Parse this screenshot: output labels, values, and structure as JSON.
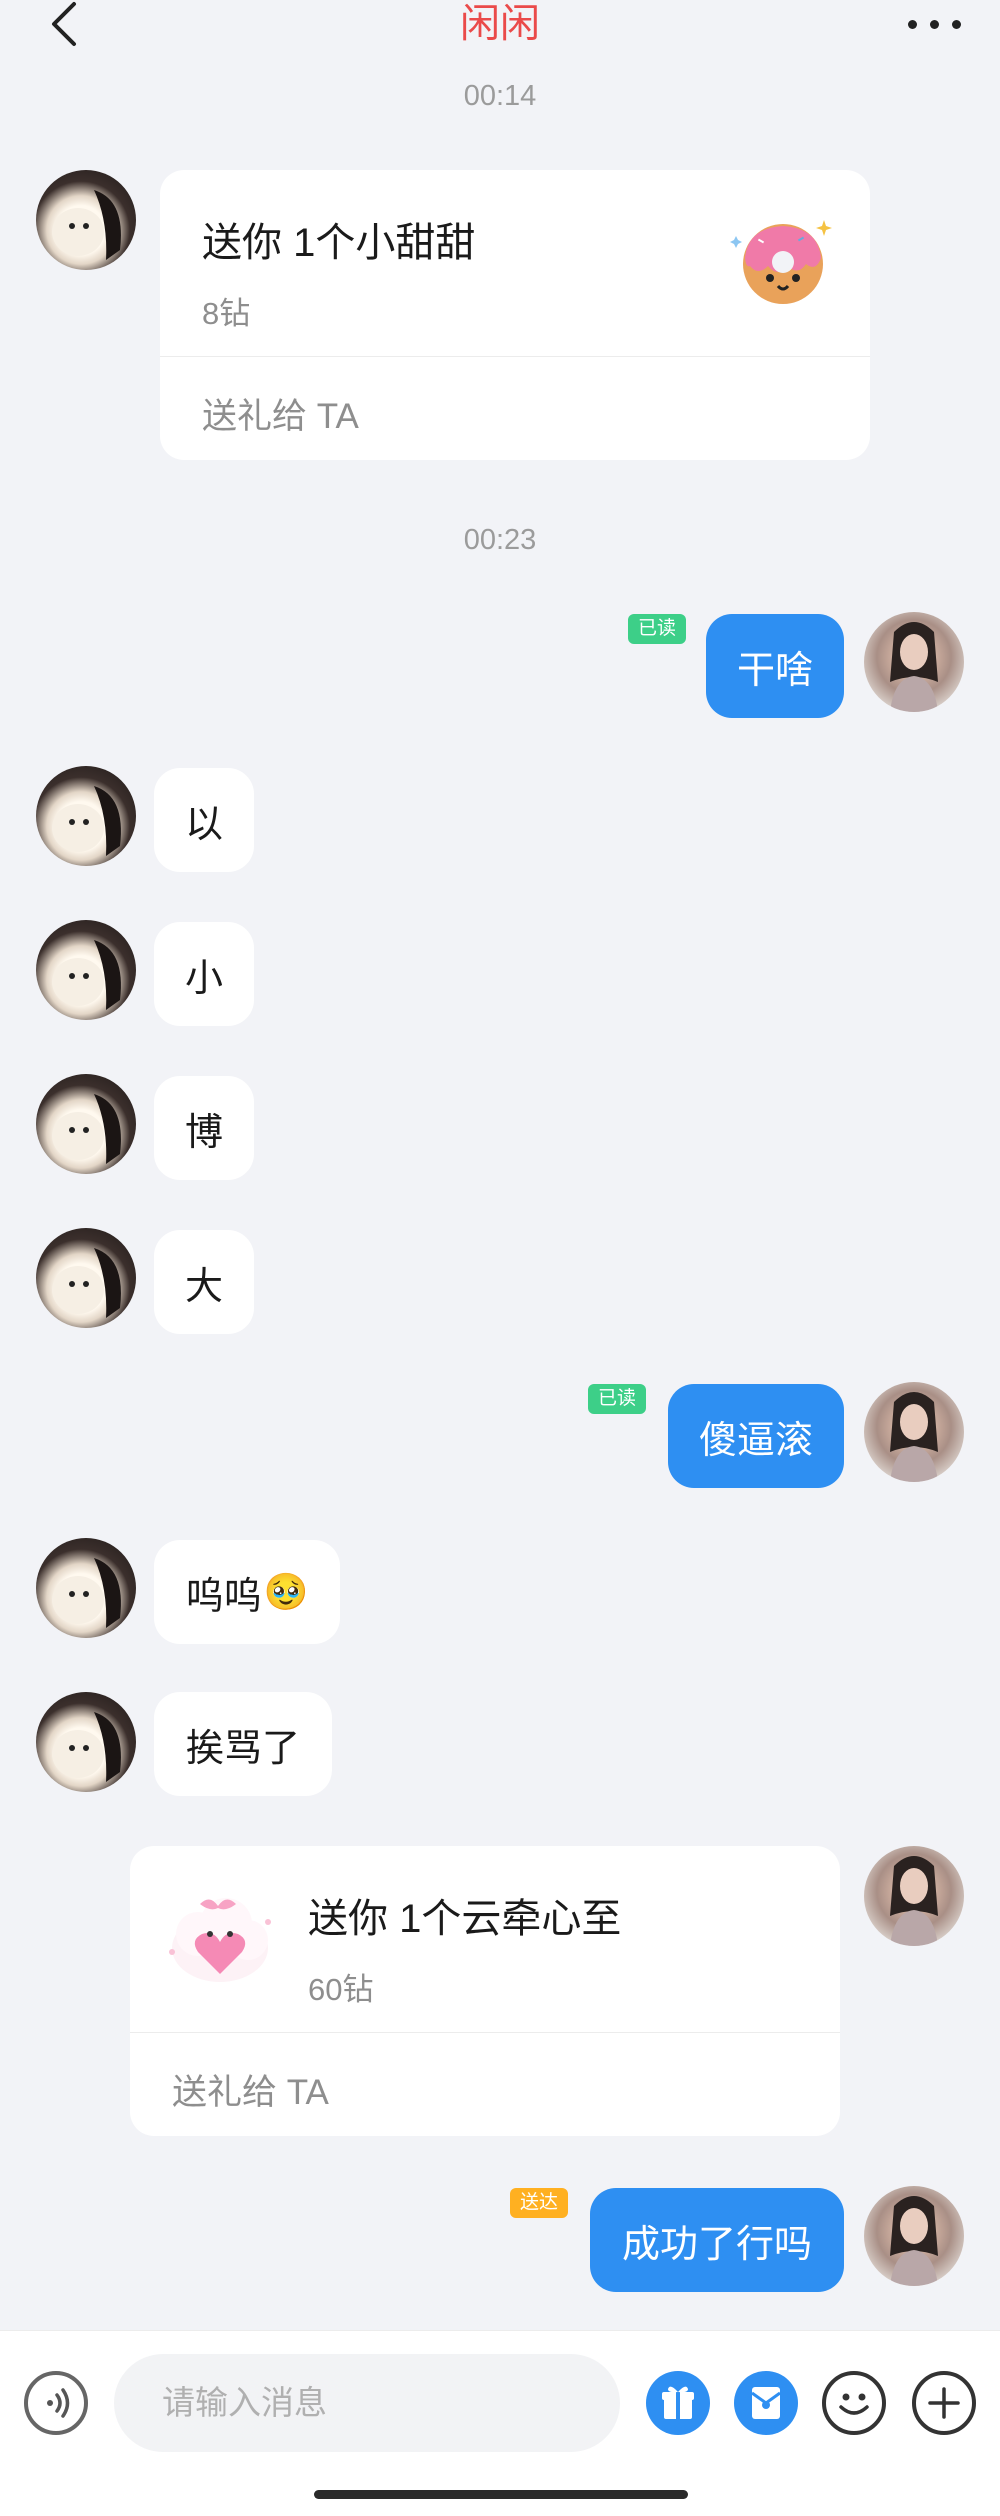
{
  "header": {
    "title": "闲闲"
  },
  "timestamps": [
    "00:14",
    "00:23"
  ],
  "messages": {
    "gift_received": {
      "title": "送你 1个小甜甜",
      "price": "8钻",
      "action": "送礼给 TA",
      "icon": "donut-gift-icon"
    },
    "sent_1": {
      "text": "干啥",
      "status": "已读"
    },
    "recv_1": {
      "text": "以"
    },
    "recv_2": {
      "text": "小"
    },
    "recv_3": {
      "text": "博"
    },
    "recv_4": {
      "text": "大"
    },
    "sent_2": {
      "text": "傻逼滚",
      "status": "已读"
    },
    "recv_5": {
      "text": "呜呜",
      "emoji": "🥹"
    },
    "recv_6": {
      "text": "挨骂了"
    },
    "gift_sent": {
      "title": "送你 1个云牵心至",
      "price": "60钻",
      "action": "送礼给 TA",
      "icon": "cloud-heart-gift-icon"
    },
    "sent_3": {
      "text": "成功了行吗",
      "status": "送达"
    }
  },
  "input": {
    "placeholder": "请输入消息"
  },
  "colors": {
    "title": "#ea4a4a",
    "my_bubble": "#2e8ff2",
    "read_tag": "#3dcf88",
    "delivered_tag": "#ffb021",
    "background": "#f2f3f7"
  }
}
